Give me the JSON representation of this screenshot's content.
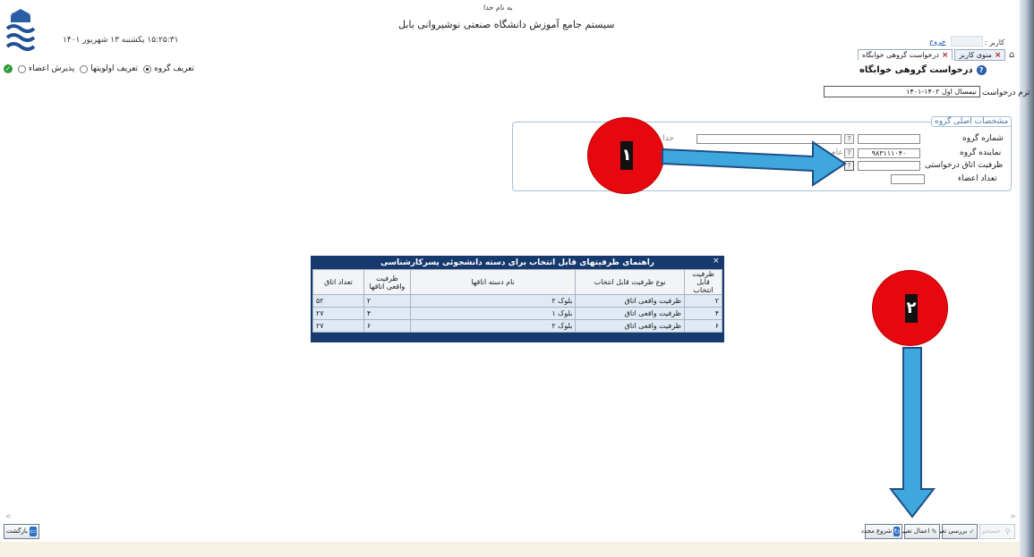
{
  "header": {
    "besm": "به نام خدا",
    "title": "سیستم جامع آموزش   دانشگاه صنعتی نوشیروانی بابل",
    "datetime": "۱۵:۲۵:۳۱ یکشنبه ۱۳ شهریور ۱۴۰۱",
    "user_label": "کاربر :",
    "logout": "خروج"
  },
  "tabs": [
    {
      "label": "منوی کاربر",
      "active": false
    },
    {
      "label": "درخواست گروهی خوابگاه",
      "active": true
    }
  ],
  "steps": [
    {
      "label": "تعریف گروه",
      "selected": true
    },
    {
      "label": "تعریف اولویتها",
      "selected": false
    },
    {
      "label": "پذیرش اعضاء",
      "selected": false
    }
  ],
  "page": {
    "title": "درخواست گروهی خوابگاه",
    "term_label": "ترم درخواست",
    "term_value": "نیمسال اول ۱۴۰۲-۱۴۰۱"
  },
  "group": {
    "legend": "مشخصات اصلی گروه",
    "fields": {
      "group_number": "شماره گروه",
      "representative": "نماینده گروه",
      "representative_value": "۹۸۳۱۱۱۰۴۰",
      "capacity": "ظرفیت اتاق درخواستی",
      "members": "تعداد اعضاء"
    },
    "stub1": "جدا",
    "stub2": "عام"
  },
  "markers": {
    "one": "۱",
    "two": "۲"
  },
  "popup": {
    "title": "راهنمای ظرفیتهای قابل انتخاب برای دسته دانشجوئی پسرکارشناسی",
    "close": "×",
    "headers": [
      "ظرفیت قابل انتخاب",
      "نوع ظرفیت قابل انتخاب",
      "نام دسته اتاقها",
      "ظرفیت واقعی اتاقها",
      "تعداد اتاق"
    ],
    "rows": [
      [
        "۲",
        "ظرفیت واقعی اتاق",
        "بلوک ۲",
        "۲",
        "۵۲"
      ],
      [
        "۴",
        "ظرفیت واقعی اتاق",
        "بلوک ۱",
        "۴",
        "۲۷"
      ],
      [
        "۶",
        "ظرفیت واقعی اتاق",
        "بلوک ۲",
        "۶",
        "۲۷"
      ]
    ]
  },
  "toolbar": {
    "back": "بازگشت",
    "search": "جستجو",
    "review": "بررسی تغییرات",
    "apply": "اعمال تغییرات",
    "new": "شروع مجدد"
  }
}
